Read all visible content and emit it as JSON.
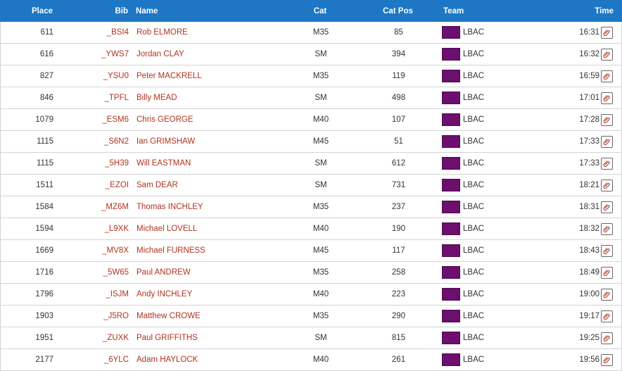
{
  "header": {
    "place": "Place",
    "bib": "Bib",
    "name": "Name",
    "cat": "Cat",
    "catpos": "Cat Pos",
    "team": "Team",
    "time": "Time"
  },
  "colors": {
    "header_bg": "#1d77c4",
    "link": "#b0331f",
    "team_swatch": "#6d0f6e",
    "clip_icon": "#b0331f"
  },
  "rows": [
    {
      "place": "611",
      "bib": "_BSI4",
      "name": "Rob ELMORE",
      "cat": "M35",
      "catpos": "85",
      "team": "LBAC",
      "time": "16:31"
    },
    {
      "place": "616",
      "bib": "_YWS7",
      "name": "Jordan CLAY",
      "cat": "SM",
      "catpos": "394",
      "team": "LBAC",
      "time": "16:32"
    },
    {
      "place": "827",
      "bib": "_YSU0",
      "name": "Peter MACKRELL",
      "cat": "M35",
      "catpos": "119",
      "team": "LBAC",
      "time": "16:59"
    },
    {
      "place": "846",
      "bib": "_TPFL",
      "name": "Billy MEAD",
      "cat": "SM",
      "catpos": "498",
      "team": "LBAC",
      "time": "17:01"
    },
    {
      "place": "1079",
      "bib": "_ESM6",
      "name": "Chris GEORGE",
      "cat": "M40",
      "catpos": "107",
      "team": "LBAC",
      "time": "17:28"
    },
    {
      "place": "1115",
      "bib": "_S6N2",
      "name": "Ian GRIMSHAW",
      "cat": "M45",
      "catpos": "51",
      "team": "LBAC",
      "time": "17:33"
    },
    {
      "place": "1115",
      "bib": "_5H39",
      "name": "Will EASTMAN",
      "cat": "SM",
      "catpos": "612",
      "team": "LBAC",
      "time": "17:33"
    },
    {
      "place": "1511",
      "bib": "_EZOI",
      "name": "Sam DEAR",
      "cat": "SM",
      "catpos": "731",
      "team": "LBAC",
      "time": "18:21"
    },
    {
      "place": "1584",
      "bib": "_MZ6M",
      "name": "Thomas INCHLEY",
      "cat": "M35",
      "catpos": "237",
      "team": "LBAC",
      "time": "18:31"
    },
    {
      "place": "1594",
      "bib": "_L9XK",
      "name": "Michael LOVELL",
      "cat": "M40",
      "catpos": "190",
      "team": "LBAC",
      "time": "18:32"
    },
    {
      "place": "1669",
      "bib": "_MV8X",
      "name": "Michael FURNESS",
      "cat": "M45",
      "catpos": "117",
      "team": "LBAC",
      "time": "18:43"
    },
    {
      "place": "1716",
      "bib": "_5W65",
      "name": "Paul ANDREW",
      "cat": "M35",
      "catpos": "258",
      "team": "LBAC",
      "time": "18:49"
    },
    {
      "place": "1796",
      "bib": "_ISJM",
      "name": "Andy INCHLEY",
      "cat": "M40",
      "catpos": "223",
      "team": "LBAC",
      "time": "19:00"
    },
    {
      "place": "1903",
      "bib": "_J5RO",
      "name": "Matthew CROWE",
      "cat": "M35",
      "catpos": "290",
      "team": "LBAC",
      "time": "19:17"
    },
    {
      "place": "1951",
      "bib": "_ZUXK",
      "name": "Paul GRIFFITHS",
      "cat": "SM",
      "catpos": "815",
      "team": "LBAC",
      "time": "19:25"
    },
    {
      "place": "2177",
      "bib": "_6YLC",
      "name": "Adam HAYLOCK",
      "cat": "M40",
      "catpos": "261",
      "team": "LBAC",
      "time": "19:56"
    }
  ]
}
